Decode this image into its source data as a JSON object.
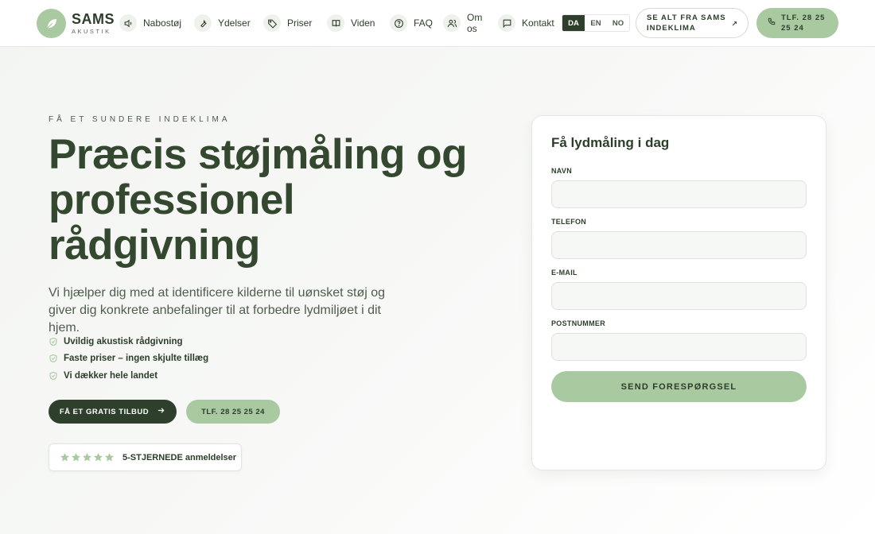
{
  "colors": {
    "brand_dark": "#2e3f2c",
    "brand_sage": "#a9c9a1",
    "heading": "#34472f",
    "text": "#4e5d4c"
  },
  "header": {
    "logo": {
      "name": "SAMS",
      "sub": "AKUSTIK",
      "icon": "leaf-icon"
    },
    "nav": [
      {
        "label": "Nabostøj",
        "icon": "speaker-icon"
      },
      {
        "label": "Ydelser",
        "icon": "wrench-icon"
      },
      {
        "label": "Priser",
        "icon": "tag-icon"
      },
      {
        "label": "Viden",
        "icon": "book-icon"
      },
      {
        "label": "FAQ",
        "icon": "help-circle-icon"
      },
      {
        "label": "Om os",
        "icon": "users-icon"
      },
      {
        "label": "Kontakt",
        "icon": "message-square-icon"
      }
    ],
    "languages": [
      {
        "code": "DA",
        "active": true
      },
      {
        "code": "EN",
        "active": false
      },
      {
        "code": "NO",
        "active": false
      }
    ],
    "indeklima_button": {
      "label": "SE ALT FRA SAMS INDEKLIMA",
      "icon": "external-arrow-icon"
    },
    "phone_button": {
      "label": "TLF. 28 25 25 24",
      "icon": "phone-icon"
    }
  },
  "hero": {
    "eyebrow": "FÅ ET SUNDERE INDEKLIMA",
    "title": "Præcis støjmåling og professionel rådgivning",
    "lead": "Vi hjælper dig med at identificere kilderne til uønsket støj og giver dig konkrete anbefalinger til at forbedre lydmiljøet i dit hjem.",
    "checks": [
      "Uvildig akustisk rådgivning",
      "Faste priser – ingen skjulte tillæg",
      "Vi dækker hele landet"
    ],
    "cta_primary": {
      "label": "FÅ ET GRATIS TILBUD",
      "icon": "arrow-right-icon"
    },
    "cta_secondary": {
      "label": "TLF. 28 25 25 24"
    },
    "reviews": {
      "stars": 5,
      "label": "5-STJERNEDE anmeldelser"
    }
  },
  "form": {
    "title": "Få lydmåling i dag",
    "fields": [
      {
        "label": "NAVN",
        "value": "",
        "placeholder": ""
      },
      {
        "label": "TELEFON",
        "value": "",
        "placeholder": ""
      },
      {
        "label": "E-MAIL",
        "value": "",
        "placeholder": ""
      },
      {
        "label": "POSTNUMMER",
        "value": "",
        "placeholder": ""
      }
    ],
    "submit_label": "SEND FORESPØRGSEL"
  }
}
